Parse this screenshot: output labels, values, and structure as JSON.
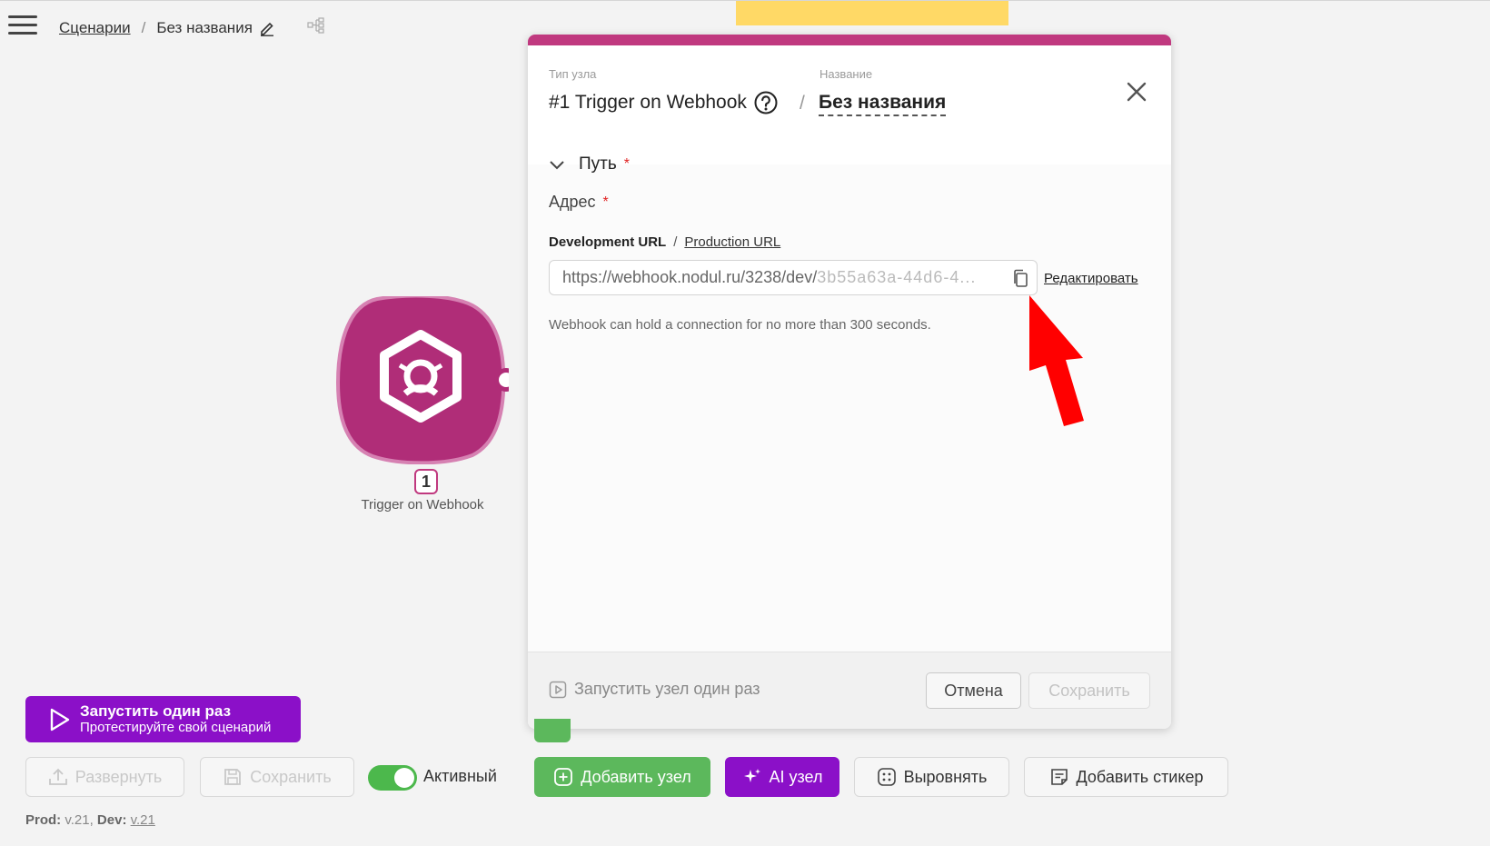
{
  "breadcrumb": {
    "scenarios": "Сценарии",
    "separator": "/",
    "current": "Без названия"
  },
  "node": {
    "number": "1",
    "label": "Trigger on Webhook",
    "color": "#b02d78"
  },
  "modal": {
    "type_label": "Тип узла",
    "type_value": "#1 Trigger on Webhook",
    "name_label": "Название",
    "slash": "/",
    "name_value": "Без названия",
    "accent_color": "#c0397f",
    "section": {
      "title": "Путь",
      "required_mark": "*"
    },
    "address_label": "Адрес",
    "url_tabs": {
      "development": "Development URL",
      "separator": "/",
      "production": "Production URL"
    },
    "url_value_main": "https://webhook.nodul.ru/3238/dev/",
    "url_value_tail": "3b55a63a-44d6-4...",
    "edit_link": "Редактировать",
    "hint": "Webhook can hold a connection for no more than 300 seconds.",
    "footer": {
      "run_once": "Запустить узел один раз",
      "cancel": "Отмена",
      "save": "Сохранить"
    }
  },
  "toolbar": {
    "run_title": "Запустить один раз",
    "run_subtitle": "Протестируйте свой сценарий",
    "deploy": "Развернуть",
    "save": "Сохранить",
    "active_label": "Активный",
    "add_node": "Добавить узел",
    "ai_node": "AI узел",
    "align": "Выровнять",
    "add_sticker": "Добавить стикер",
    "purple_color": "#8b10c8",
    "green_color": "#5cb85c"
  },
  "version": {
    "prod_label": "Prod:",
    "prod_value": "v.21,",
    "dev_label": "Dev:",
    "dev_value": "v.21"
  }
}
